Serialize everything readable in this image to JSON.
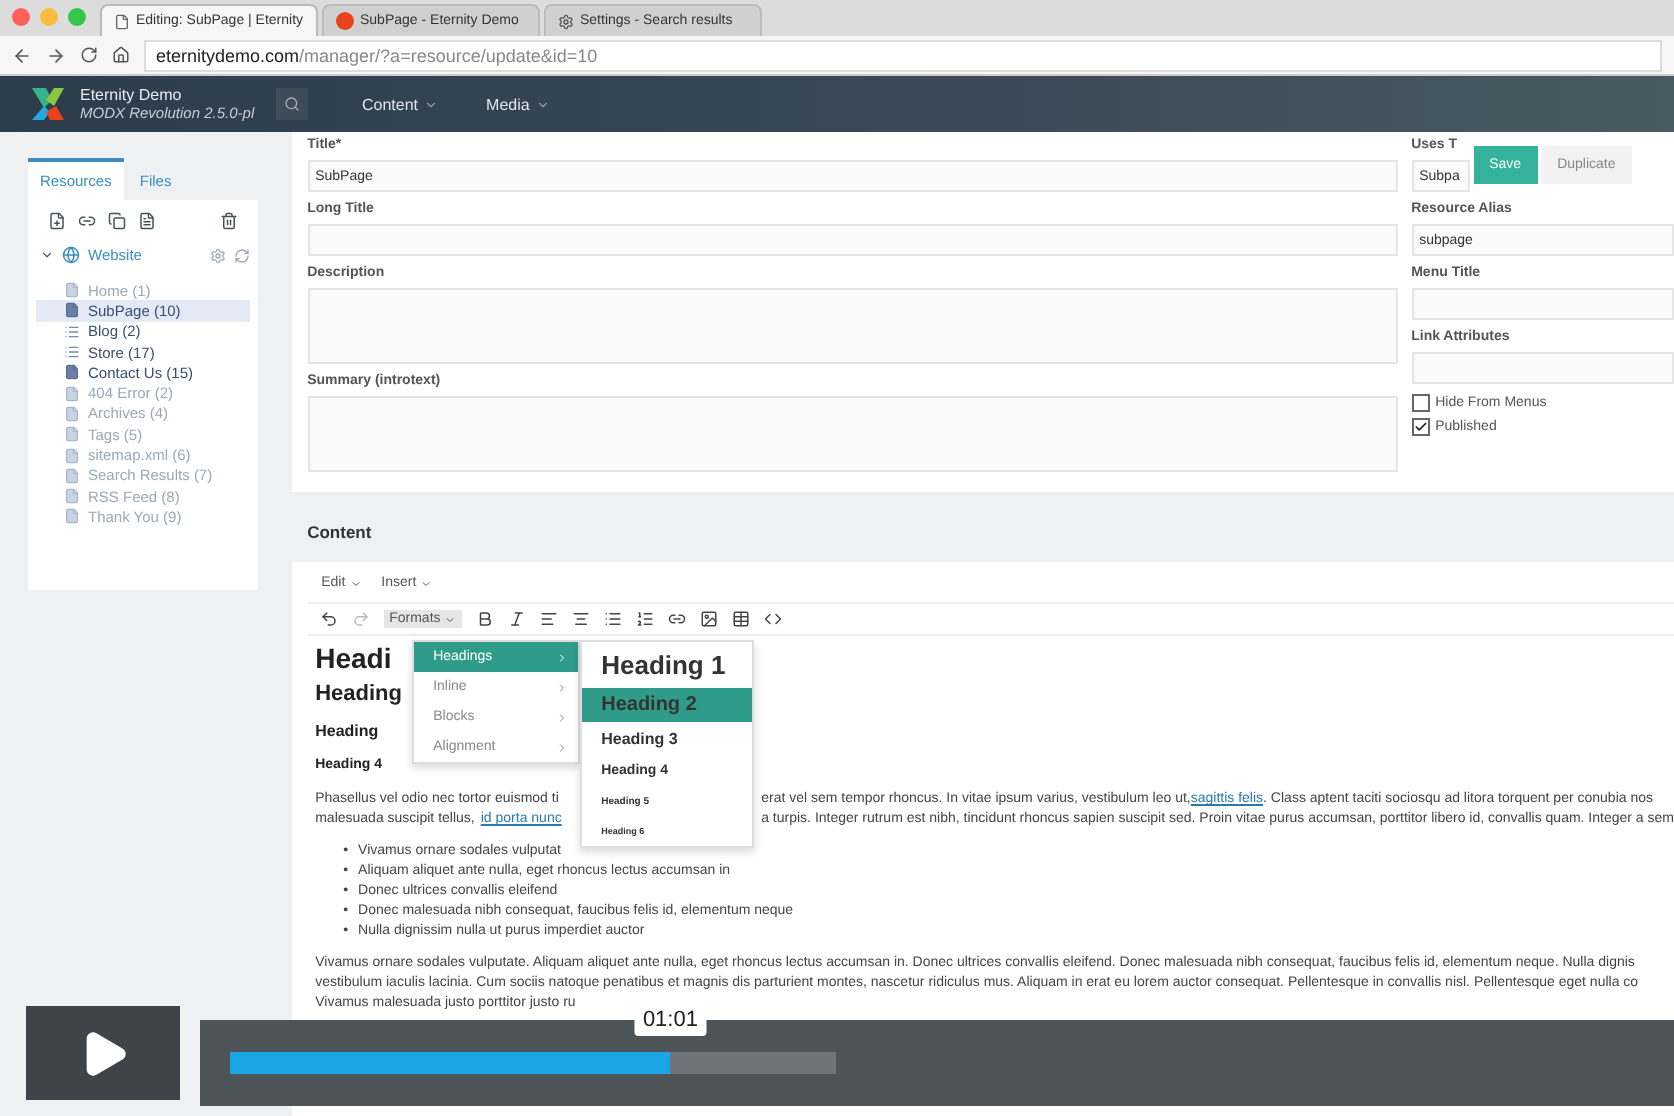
{
  "browser": {
    "tabs": [
      {
        "title": "Editing: SubPage | Eternity",
        "selected": true,
        "kind": "page"
      },
      {
        "title": "SubPage - Eternity Demo",
        "selected": false,
        "kind": "brand"
      },
      {
        "title": "Settings - Search results",
        "selected": false,
        "kind": "settings"
      }
    ],
    "address": {
      "host": "eternitydemo.com",
      "path": "/manager/?a=resource/update&id=10"
    }
  },
  "header": {
    "title": "Eternity Demo",
    "subtitle": "MODX Revolution 2.5.0-pl",
    "nav": [
      "Content",
      "Media"
    ]
  },
  "sidebar": {
    "tabs": [
      {
        "label": "Resources",
        "selected": true
      },
      {
        "label": "Files",
        "selected": false
      }
    ],
    "tree": {
      "label": "Website",
      "expanded": true,
      "children": [
        {
          "label": "Home (1)",
          "kind": "document",
          "muted": true,
          "selected": false
        },
        {
          "label": "SubPage (10)",
          "kind": "document",
          "muted": false,
          "selected": true
        },
        {
          "label": "Blog (2)",
          "kind": "collection",
          "muted": false,
          "selected": false
        },
        {
          "label": "Store (17)",
          "kind": "collection",
          "muted": false,
          "selected": false
        },
        {
          "label": "Contact Us (15)",
          "kind": "document",
          "muted": false,
          "selected": false
        },
        {
          "label": "404 Error (2)",
          "kind": "document",
          "muted": true,
          "selected": false
        },
        {
          "label": "Archives (4)",
          "kind": "document",
          "muted": true,
          "selected": false
        },
        {
          "label": "Tags (5)",
          "kind": "document",
          "muted": true,
          "selected": false
        },
        {
          "label": "sitemap.xml (6)",
          "kind": "document",
          "muted": true,
          "selected": false
        },
        {
          "label": "Search Results (7)",
          "kind": "document",
          "muted": true,
          "selected": false
        },
        {
          "label": "RSS Feed (8)",
          "kind": "document",
          "muted": true,
          "selected": false
        },
        {
          "label": "Thank You (9)",
          "kind": "document",
          "muted": true,
          "selected": false
        }
      ]
    }
  },
  "form": {
    "fields": [
      {
        "label": "Title*",
        "value": "SubPage",
        "kind": "input"
      },
      {
        "label": "Long Title",
        "kind": "input"
      },
      {
        "label": "Description",
        "kind": "textarea"
      },
      {
        "label": "Summary (introtext)",
        "kind": "textarea"
      }
    ],
    "side_fields": [
      {
        "label": "Uses T",
        "value": "Subpa"
      },
      {
        "label": "Resource Alias",
        "value": "subpage"
      },
      {
        "label": "Menu Title"
      },
      {
        "label": "Link Attributes"
      }
    ],
    "checkboxes": [
      {
        "label": "Hide From Menus",
        "checked": false
      },
      {
        "label": "Published",
        "checked": true
      }
    ],
    "buttons": [
      {
        "label": "Save",
        "kind": "primary"
      },
      {
        "label": "Duplicate",
        "kind": "plain"
      }
    ]
  },
  "content": {
    "title": "Content",
    "menubar": [
      "Edit",
      "Insert"
    ],
    "formats_label": "Formats",
    "formats_menu": [
      {
        "label": "Headings",
        "selected": true
      },
      {
        "label": "Inline",
        "selected": false
      },
      {
        "label": "Blocks",
        "selected": false
      },
      {
        "label": "Alignment",
        "selected": false
      }
    ],
    "headings_menu": [
      {
        "label": "Heading 1",
        "selected": false
      },
      {
        "label": "Heading 2",
        "selected": true
      },
      {
        "label": "Heading 3",
        "selected": false
      },
      {
        "label": "Heading 4",
        "selected": false
      },
      {
        "label": "Heading 5",
        "selected": false
      },
      {
        "label": "Heading 6",
        "selected": false
      }
    ],
    "headings": [
      "Headi",
      "Heading",
      "Heading",
      "Heading 4"
    ],
    "paragraph_1": [
      {
        "left": [
          {
            "text": "Phasellus vel odio nec tortor euismod ti",
            "kind": "text"
          }
        ],
        "right": [
          {
            "text": "erat vel sem tempor rhoncus. In vitae ipsum varius, vestibulum leo ut,",
            "kind": "text"
          },
          {
            "text": "sagittis felis",
            "kind": "link"
          },
          {
            "text": ". Class aptent taciti sociosqu ad litora torquent per conubia nos",
            "kind": "text"
          }
        ]
      },
      {
        "left": [
          {
            "text": "malesuada suscipit tellus,",
            "kind": "text"
          },
          {
            "text": "id porta nunc",
            "kind": "link"
          }
        ],
        "right": [
          {
            "text": "a turpis. Integer rutrum est nibh, tincidunt rhoncus sapien suscipit sed. Proin vitae purus accumsan, porttitor libero id, convallis quam. Integer a sem",
            "kind": "text"
          }
        ]
      }
    ],
    "list": [
      {
        "bullet": "•",
        "text": "Vivamus ornare sodales vulputat"
      },
      {
        "bullet": "•",
        "text": "Aliquam aliquet ante nulla, eget rhoncus lectus accumsan in"
      },
      {
        "bullet": "•",
        "text": "Donec ultrices convallis eleifend"
      },
      {
        "bullet": "•",
        "text": "Donec malesuada nibh consequat, faucibus felis id, elementum neque"
      },
      {
        "bullet": "•",
        "text": "Nulla dignissim nulla ut purus imperdiet auctor"
      }
    ],
    "paragraph_2": [
      "Vivamus ornare sodales vulputate. Aliquam aliquet ante nulla, eget rhoncus lectus accumsan in. Donec ultrices convallis eleifend. Donec malesuada nibh consequat, faucibus felis id, elementum neque. Nulla dignis",
      "vestibulum iaculis lacinia. Cum sociis natoque penatibus et magnis dis parturient montes, nascetur ridiculus mus. Aliquam in erat eu lorem auctor consequat. Pellentesque in convallis nisl. Pellentesque eget nulla co",
      "Vivamus malesuada justo porttitor justo ru"
    ]
  },
  "player": {
    "time": "01:01",
    "level": 0.305,
    "buffer": {
      "level": 0.42
    }
  }
}
